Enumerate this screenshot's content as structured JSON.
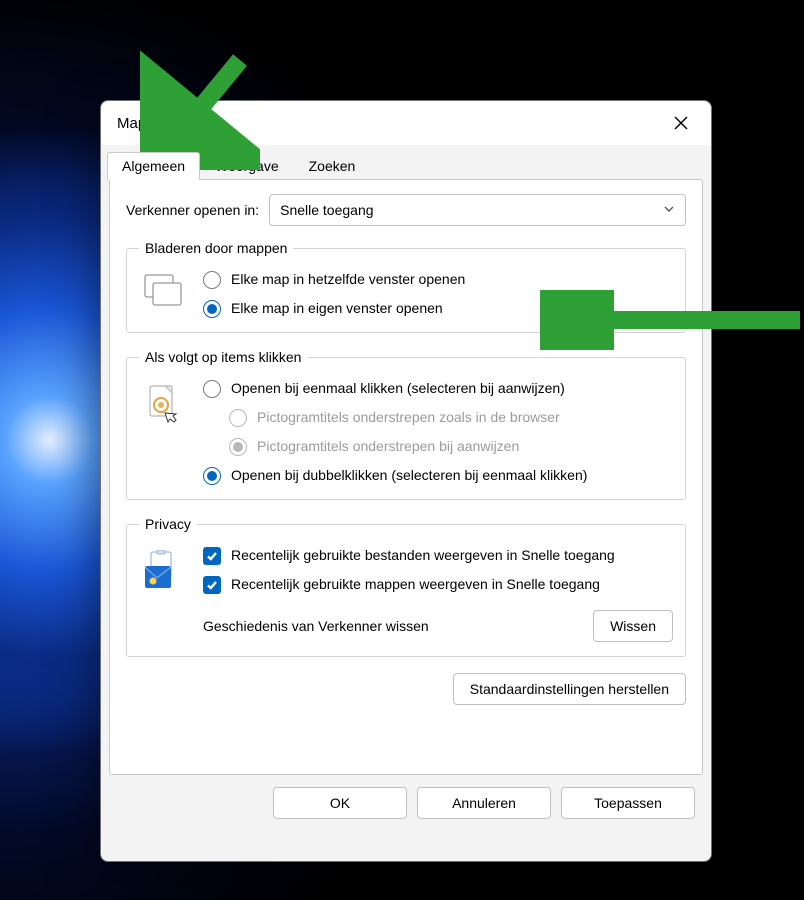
{
  "dialog": {
    "title": "Mapopties",
    "tabs": {
      "general": "Algemeen",
      "view": "Weergave",
      "search": "Zoeken"
    },
    "open_in_label": "Verkenner openen in:",
    "open_in_value": "Snelle toegang",
    "browse": {
      "legend": "Bladeren door mappen",
      "same_window": "Elke map in hetzelfde venster openen",
      "own_window": "Elke map in eigen venster openen"
    },
    "click": {
      "legend": "Als volgt op items klikken",
      "single": "Openen bij eenmaal klikken (selecteren bij aanwijzen)",
      "underline_browser": "Pictogramtitels onderstrepen zoals in de browser",
      "underline_point": "Pictogramtitels onderstrepen bij aanwijzen",
      "double": "Openen bij dubbelklikken (selecteren bij eenmaal klikken)"
    },
    "privacy": {
      "legend": "Privacy",
      "recent_files": "Recentelijk gebruikte bestanden weergeven in Snelle toegang",
      "recent_folders": "Recentelijk gebruikte mappen weergeven in Snelle toegang",
      "clear_history_label": "Geschiedenis van Verkenner wissen",
      "clear_button": "Wissen"
    },
    "restore_defaults": "Standaardinstellingen herstellen",
    "buttons": {
      "ok": "OK",
      "cancel": "Annuleren",
      "apply": "Toepassen"
    }
  }
}
